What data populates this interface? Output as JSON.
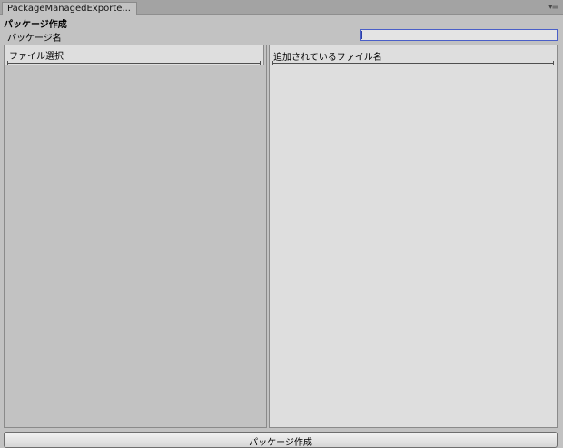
{
  "window": {
    "tab_title": "PackageManagedExporte...",
    "menu_icon": "▾≡"
  },
  "section": {
    "title": "パッケージ作成"
  },
  "package_name": {
    "label": "パッケージ名",
    "value": ""
  },
  "left_panel": {
    "title": "ファイル選択"
  },
  "right_panel": {
    "title": "追加されているファイル名"
  },
  "create_button": {
    "label": "パッケージ作成"
  }
}
